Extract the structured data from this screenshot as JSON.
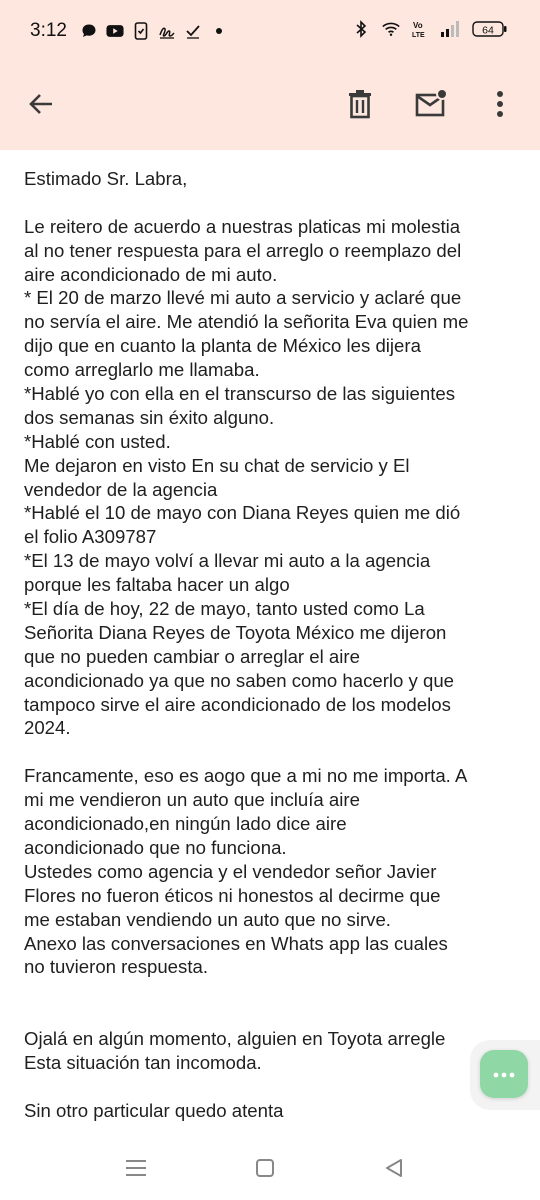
{
  "status_bar": {
    "time": "3:12",
    "battery": "64",
    "left_icons": [
      "chat-bubble-icon",
      "youtube-icon",
      "phone-check-icon",
      "signature-icon",
      "check-icon",
      "dot-icon"
    ],
    "right_icons": [
      "bluetooth-icon",
      "wifi-icon",
      "volte-icon",
      "signal-icon",
      "battery-icon"
    ]
  },
  "toolbar": {
    "icons": [
      "back-arrow-icon",
      "trash-icon",
      "mark-unread-icon",
      "more-vert-icon"
    ]
  },
  "email": {
    "lines": [
      "Estimado Sr. Labra,",
      "",
      "Le reitero de acuerdo a nuestras platicas mi molestia",
      "al no tener respuesta para el arreglo  o reemplazo del",
      "aire acondicionado de mi auto.",
      "* El 20 de marzo llevé mi auto a servicio y aclaré que",
      "no servía el aire. Me atendió la señorita Eva quien me",
      "dijo que en cuanto la planta de México les dijera",
      "como arreglarlo me llamaba.",
      "*Hablé yo con ella en el transcurso de las siguientes",
      "dos semanas sin éxito alguno.",
      "*Hablé con usted.",
      "Me dejaron en visto En su chat de servicio y El",
      "vendedor de la agencia",
      "*Hablé el 10 de mayo con Diana Reyes quien me dió",
      "el folio A309787",
      "*El 13 de mayo volví a llevar mi auto a la agencia",
      "porque les faltaba hacer un algo",
      "*El día de hoy, 22 de mayo, tanto usted como La",
      "Señorita Diana Reyes de Toyota México me dijeron",
      "que no pueden cambiar o arreglar el aire",
      "acondicionado ya que no saben como hacerlo y que",
      "tampoco sirve el aire acondicionado de los modelos",
      "2024.",
      "",
      "Francamente, eso es aogo que a mi no me importa. A",
      "mi me vendieron un auto que incluía aire",
      "acondicionado,en ningún lado dice aire",
      "acondicionado que no funciona.",
      "Ustedes como agencia y el vendedor señor Javier",
      "Flores no fueron éticos ni honestos al decirme que",
      "me estaban vendiendo un auto que no sirve.",
      "Anexo las conversaciones en Whats app las cuales",
      "no tuvieron respuesta.",
      "",
      "",
      "Ojalá en algún momento, alguien en Toyota arregle",
      "Esta situación tan incomoda.",
      "",
      "Sin otro particular quedo atenta"
    ]
  },
  "fab": {
    "icon": "more-horiz-icon",
    "color": "#8fd7a4"
  },
  "nav": {
    "icons": [
      "recents-icon",
      "home-icon",
      "back-icon"
    ]
  }
}
